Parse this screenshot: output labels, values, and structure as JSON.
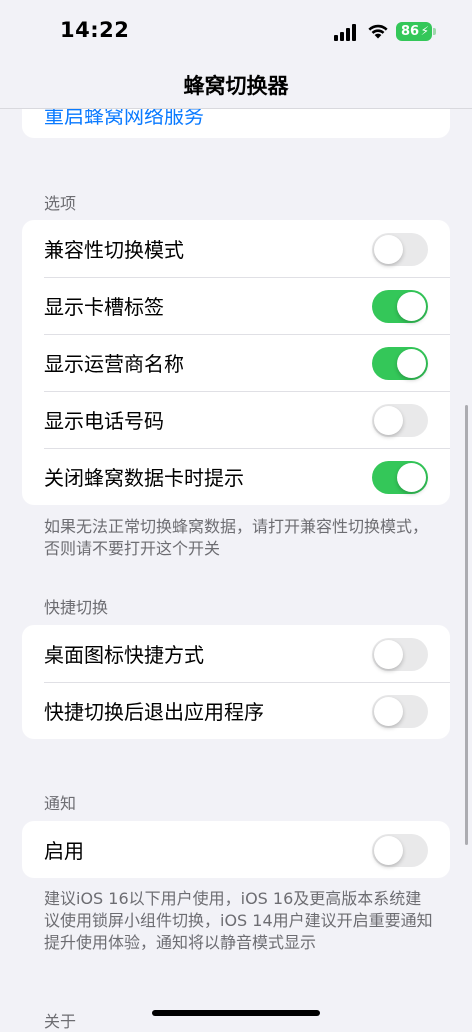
{
  "status": {
    "time": "14:22",
    "battery": "86"
  },
  "nav": {
    "title": "蜂窝切换器"
  },
  "top_card": {
    "link": "重启蜂窝网络服务"
  },
  "options": {
    "header": "选项",
    "rows": [
      {
        "label": "兼容性切换模式",
        "on": false
      },
      {
        "label": "显示卡槽标签",
        "on": true
      },
      {
        "label": "显示运营商名称",
        "on": true
      },
      {
        "label": "显示电话号码",
        "on": false
      },
      {
        "label": "关闭蜂窝数据卡时提示",
        "on": true
      }
    ],
    "footer": "如果无法正常切换蜂窝数据，请打开兼容性切换模式，否则请不要打开这个开关"
  },
  "shortcuts": {
    "header": "快捷切换",
    "rows": [
      {
        "label": "桌面图标快捷方式",
        "on": false
      },
      {
        "label": "快捷切换后退出应用程序",
        "on": false
      }
    ]
  },
  "notify": {
    "header": "通知",
    "rows": [
      {
        "label": "启用",
        "on": false
      }
    ],
    "footer": "建议iOS 16以下用户使用，iOS 16及更高版本系统建议使用锁屏小组件切换，iOS 14用户建议开启重要通知提升使用体验，通知将以静音模式显示"
  },
  "about": {
    "header": "关于"
  },
  "colors": {
    "accent": "#0a7aff",
    "toggle_on": "#34c759",
    "background": "#f2f2f7"
  }
}
